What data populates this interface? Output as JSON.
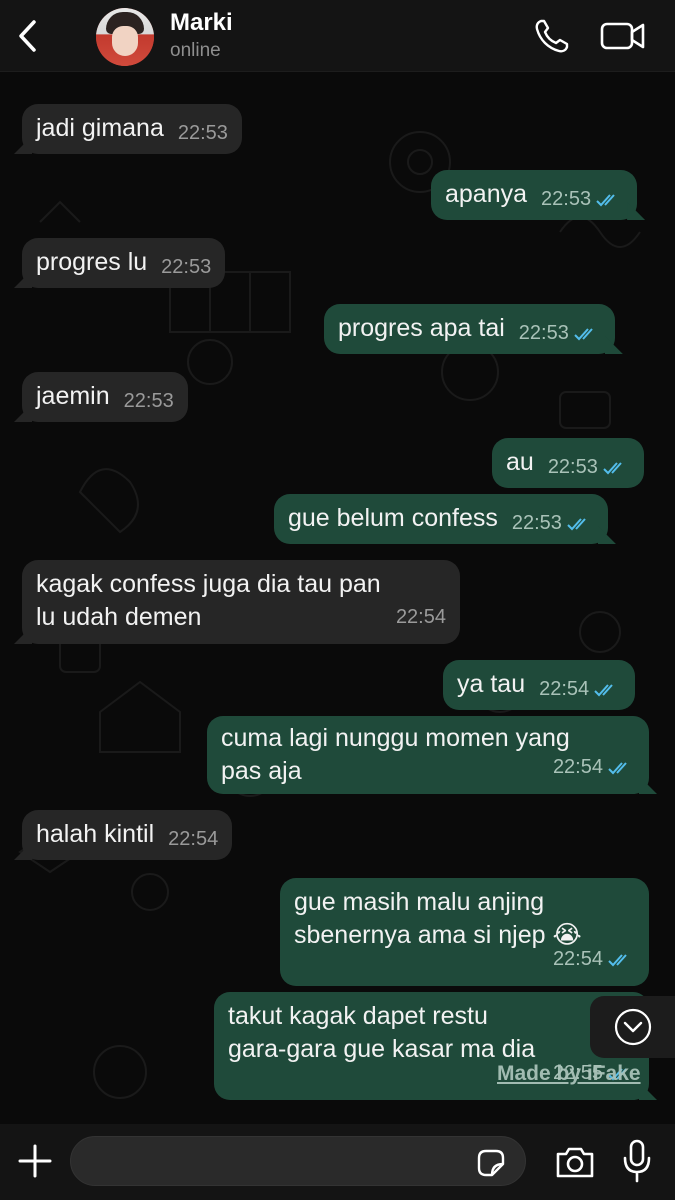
{
  "header": {
    "back_icon": "chevron-left-icon",
    "contact_name": "Marki",
    "status": "online",
    "call_icon": "phone-icon",
    "video_icon": "video-camera-icon"
  },
  "messages": [
    {
      "dir": "in",
      "text": "jadi gimana",
      "time": "22:53"
    },
    {
      "dir": "out",
      "text": "apanya",
      "time": "22:53",
      "read": true
    },
    {
      "dir": "in",
      "text": "progres lu",
      "time": "22:53"
    },
    {
      "dir": "out",
      "text": "progres apa tai",
      "time": "22:53",
      "read": true
    },
    {
      "dir": "in",
      "text": "jaemin",
      "time": "22:53"
    },
    {
      "dir": "out",
      "text": "au",
      "time": "22:53",
      "read": true
    },
    {
      "dir": "out",
      "text": "gue belum confess",
      "time": "22:53",
      "read": true
    },
    {
      "dir": "in",
      "text": "kagak confess juga dia tau pan\nlu udah demen",
      "time": "22:54"
    },
    {
      "dir": "out",
      "text": "ya tau",
      "time": "22:54",
      "read": true
    },
    {
      "dir": "out",
      "text": "cuma lagi nunggu momen yang\npas aja",
      "time": "22:54",
      "read": true
    },
    {
      "dir": "in",
      "text": "halah kintil",
      "time": "22:54"
    },
    {
      "dir": "out",
      "text": "gue masih malu anjing\nsbenernya ama si njep 😭",
      "time": "22:54",
      "read": true
    },
    {
      "dir": "out",
      "text": "takut kagak dapet restu\ngara-gara gue kasar ma dia",
      "time": "22:55",
      "read": true
    }
  ],
  "watermark": "Made by iFake",
  "scroll_down_icon": "chevron-down-circle-icon",
  "input_bar": {
    "placeholder": "",
    "plus_icon": "plus-icon",
    "sticker_icon": "sticker-icon",
    "camera_icon": "camera-icon",
    "mic_icon": "microphone-icon"
  },
  "colors": {
    "incoming_bubble": "#262626",
    "outgoing_bubble": "#1f4a3a",
    "read_ticks": "#53bdeb",
    "background": "#0a0a0a"
  }
}
